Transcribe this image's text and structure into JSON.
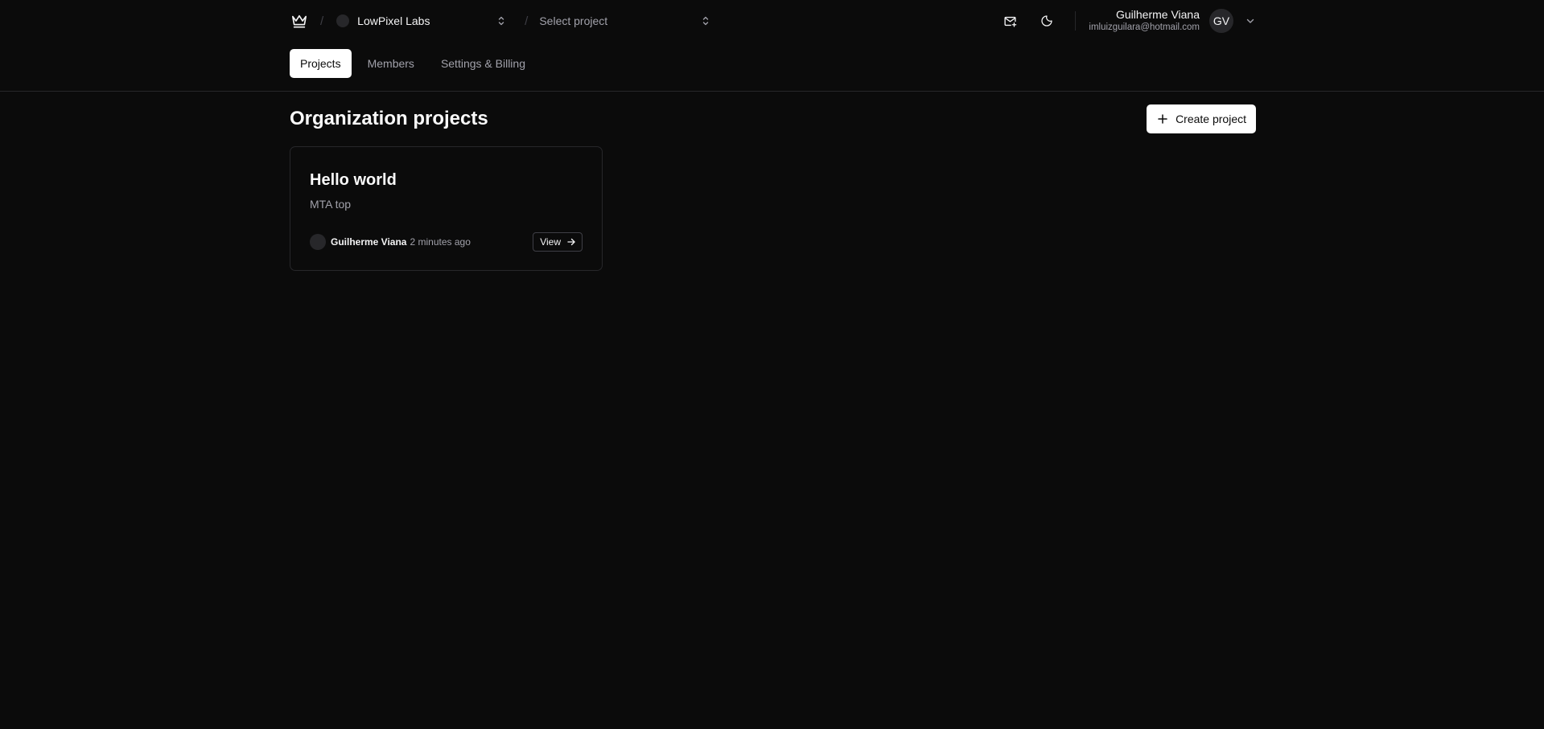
{
  "header": {
    "logo_icon": "crown-icon",
    "separator": "/",
    "org_select": {
      "label": "LowPixel Labs",
      "icon": "chevrons-up-down-icon"
    },
    "project_select": {
      "placeholder": "Select project",
      "icon": "chevrons-up-down-icon"
    },
    "invites_icon": "mail-plus-icon",
    "theme_icon": "moon-icon",
    "user": {
      "name": "Guilherme Viana",
      "email": "imluizguilara@hotmail.com",
      "initials": "GV"
    }
  },
  "tabs": [
    {
      "label": "Projects",
      "active": true
    },
    {
      "label": "Members",
      "active": false
    },
    {
      "label": "Settings & Billing",
      "active": false
    }
  ],
  "main": {
    "title": "Organization projects",
    "create_button_label": "Create project",
    "projects": [
      {
        "name": "Hello world",
        "description": "MTA top",
        "owner": "Guilherme Viana",
        "time_ago": "2 minutes ago",
        "view_label": "View"
      }
    ]
  },
  "colors": {
    "background": "#0b0b0b",
    "border": "#27272a",
    "muted_text": "#a1a1aa",
    "primary_button": "#ffffff"
  }
}
